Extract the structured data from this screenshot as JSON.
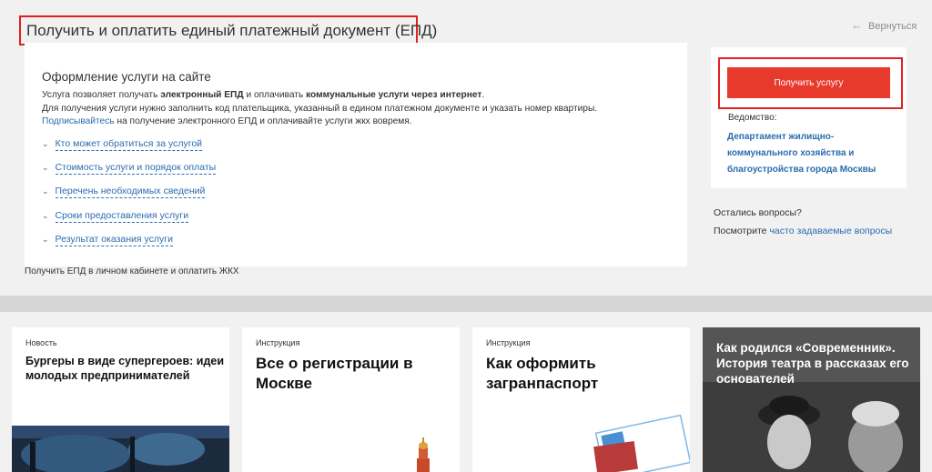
{
  "header": {
    "title": "Получить и оплатить единый платежный документ (ЕПД)",
    "back_label": "Вернуться"
  },
  "main": {
    "section_title": "Оформление услуги на сайте",
    "desc": {
      "l1_a": "Услуга позволяет получать ",
      "l1_b": "электронный ЕПД",
      "l1_c": " и оплачивать ",
      "l1_d": "коммунальные услуги через интернет",
      "l1_e": ".",
      "l2": "Для получения услуги нужно заполнить код плательщика, указанный в едином платежном документе и указать номер квартиры.",
      "l3_link": "Подписывайтесь",
      "l3_rest": " на получение электронного ЕПД и оплачивайте услуги жкх вовремя."
    },
    "accordion": [
      "Кто может обратиться за услугой",
      "Стоимость услуги и порядок оплаты",
      "Перечень необходимых сведений",
      "Сроки предоставления услуги",
      "Результат оказания услуги"
    ],
    "caption": "Получить ЕПД в личном кабинете и оплатить ЖКХ"
  },
  "sidebar": {
    "button_label": "Получить услугу",
    "dept_label": "Ведомство:",
    "dept_name": "Департамент жилищно-коммунального хозяйства и благоустройства города Москвы",
    "questions": "Остались вопросы?",
    "faq_prefix": "Посмотрите ",
    "faq_link": "часто задаваемые вопросы"
  },
  "news": [
    {
      "type": "Новость",
      "title": "Бургеры в виде супергероев: идеи молодых предпринимателей"
    },
    {
      "type": "Инструкция",
      "title": "Все о регистрации в Москве"
    },
    {
      "type": "Инструкция",
      "title": "Как оформить загранпаспорт"
    },
    {
      "type": "",
      "title": "Как родился «Современник». История театра в рассказах его основателей"
    }
  ],
  "colors": {
    "accent": "#e8392d",
    "highlight": "#e02121",
    "link": "#2b6cb0"
  },
  "icons": {
    "back": "arrow-left-icon",
    "accordion": "chevron-down-icon"
  }
}
